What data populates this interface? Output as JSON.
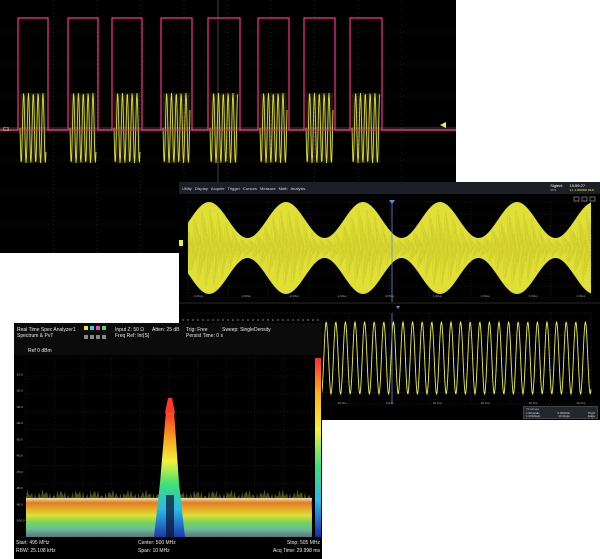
{
  "colors": {
    "pulse": "#ff2f8f",
    "burst": "#e9e83a",
    "trace_yellow": "#f2f23a",
    "grid": "#3a3a3a",
    "panel_bg": "#000000",
    "toolbar_bg": "#1c1f26",
    "cursor_blue": "#5a8fe0"
  },
  "scope_top": {
    "channel_tag": "C1",
    "trigger_marker_icon": "triangle-left-icon"
  },
  "scope_mid": {
    "toolbar": {
      "items": [
        "Utility",
        "Display",
        "Acquire",
        "Trigger",
        "Cursors",
        "Measure",
        "Math",
        "Analysis"
      ]
    },
    "brand": {
      "line1": "Siglent",
      "line2": "SDS"
    },
    "status_right": {
      "top": "10:59:27",
      "sub": "1:1 1.000000 MHz"
    },
    "upper_tick_labels": [
      "-4.00us",
      "-3.00us",
      "-2.00us",
      "-1.00us",
      "0.00us",
      "1.00us",
      "2.00us",
      "3.00us",
      "4.00us"
    ],
    "lower_tick_labels": [
      "-40.0ns",
      "-30.0ns",
      "-20.0ns",
      "-10.0ns",
      "0.0ns",
      "10.0ns",
      "20.0ns",
      "30.0ns",
      "40.0ns"
    ],
    "info_box": {
      "title": "Timebase",
      "rows": [
        [
          "1.00us/div",
          "0.00000s",
          "Trig'd"
        ],
        [
          "1.00GSa/s",
          "10.0kpts",
          "Edge"
        ]
      ]
    }
  },
  "spectrum": {
    "title_line1": "Real Time Spec Analyzer1",
    "title_line2": "Spectrum & PvT",
    "input": "Input Z: 50 Ω",
    "atten": "Atten: 25 dB",
    "freq_ref": "Freq Ref: Int(S)",
    "trig": "Trig: Free",
    "sweep": "Sweep: Single",
    "density": "Density",
    "persist": "Persist Time: 0 s",
    "ref": "Ref 0 dBm",
    "y_labels": [
      "-10.0",
      "-20.0",
      "-30.0",
      "-40.0",
      "-50.0",
      "-60.0",
      "-70.0",
      "-80.0",
      "-90.0",
      "-100.0"
    ],
    "start": "Start: 495 MHz",
    "center": "Center: 500 MHz",
    "stop": "Stop: 505 MHz",
    "rbw": "RBW: 25.108 kHz",
    "span": "Span: 10 MHz",
    "acq": "Acq Time: 29.998 ms"
  }
}
